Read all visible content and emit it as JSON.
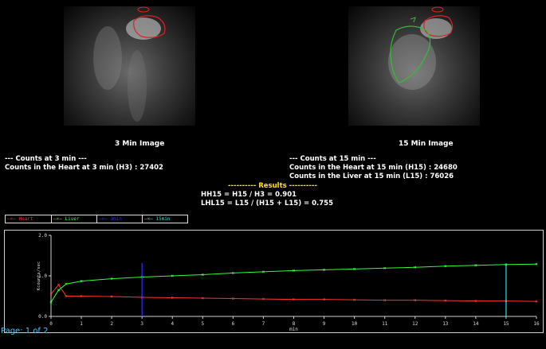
{
  "images": {
    "left_caption": "3 Min Image",
    "right_caption": "15 Min Image"
  },
  "counts3": {
    "header": "--- Counts at 3 min ---",
    "heart": "Counts in the Heart at 3 min (H3) : 27402"
  },
  "counts15": {
    "header": "--- Counts at 15 min ---",
    "heart": "Counts in the Heart at 15 min (H15) : 24680",
    "liver": "Counts in the Liver at 15 min (L15) : 76026"
  },
  "results": {
    "title": "---------- Results ----------",
    "hh15": "HH15 = H15 / H3 = 0.901",
    "lhl15": "LHL15 = L15 / (H15 + L15) = 0.755"
  },
  "legend": [
    {
      "label": "Heart",
      "color": "#ff3030",
      "marker": "x"
    },
    {
      "label": "Liver",
      "color": "#30ff30",
      "marker": "x"
    },
    {
      "label": "3min",
      "color": "#3030ff",
      "marker": "x"
    },
    {
      "label": "15min",
      "color": "#30e0e0",
      "marker": "x"
    }
  ],
  "chart_data": {
    "type": "line",
    "xlabel": "min",
    "ylabel": "Kcounts/sec",
    "xlim": [
      0,
      16
    ],
    "ylim": [
      0,
      2.0
    ],
    "xticks": [
      "0",
      "1",
      "2",
      "3",
      "4",
      "5",
      "6",
      "7",
      "8",
      "9",
      "10",
      "11",
      "12",
      "13",
      "14",
      "15",
      "16"
    ],
    "yticks": [
      "0.0",
      "1.0",
      "2.0"
    ],
    "series": [
      {
        "name": "Heart",
        "color": "#ff3030",
        "x": [
          0,
          0.25,
          0.5,
          1,
          2,
          3,
          4,
          5,
          6,
          7,
          8,
          9,
          10,
          11,
          12,
          13,
          14,
          15,
          16
        ],
        "y": [
          0.55,
          0.78,
          0.5,
          0.5,
          0.49,
          0.47,
          0.46,
          0.45,
          0.44,
          0.43,
          0.42,
          0.42,
          0.41,
          0.4,
          0.4,
          0.39,
          0.38,
          0.38,
          0.37
        ]
      },
      {
        "name": "Liver",
        "color": "#30ff30",
        "x": [
          0,
          0.25,
          0.5,
          1,
          2,
          3,
          4,
          5,
          6,
          7,
          8,
          9,
          10,
          11,
          12,
          13,
          14,
          15,
          16
        ],
        "y": [
          0.35,
          0.65,
          0.8,
          0.87,
          0.93,
          0.97,
          1.0,
          1.03,
          1.07,
          1.1,
          1.13,
          1.15,
          1.17,
          1.19,
          1.21,
          1.24,
          1.26,
          1.28,
          1.29
        ]
      }
    ],
    "markers": [
      {
        "name": "3min",
        "x": 3,
        "color": "#3030ff",
        "ymax": 1.32
      },
      {
        "name": "15min",
        "x": 15,
        "color": "#30e0e0",
        "ymax": 1.3
      }
    ]
  },
  "footer": {
    "page_label": "Page: 1 of 2"
  }
}
